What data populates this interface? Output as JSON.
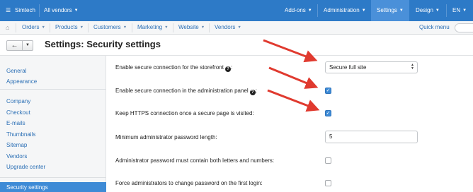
{
  "topbar": {
    "brand": "Simtech",
    "vendor_select": "All vendors",
    "addons": "Add-ons",
    "administration": "Administration",
    "settings": "Settings",
    "design": "Design",
    "language": "EN"
  },
  "nav": {
    "items": [
      "Orders",
      "Products",
      "Customers",
      "Marketing",
      "Website",
      "Vendors"
    ],
    "quick_menu": "Quick menu"
  },
  "page": {
    "title": "Settings: Security settings"
  },
  "sidebar": {
    "items": [
      "General",
      "Appearance",
      "Company",
      "Checkout",
      "E-mails",
      "Thumbnails",
      "Sitemap",
      "Vendors",
      "Upgrade center"
    ],
    "active": "Security settings"
  },
  "settings": {
    "rows": [
      {
        "label": "Enable secure connection for the storefront",
        "control": "select",
        "value": "Secure full site"
      },
      {
        "label": "Enable secure connection in the administration panel",
        "control": "checkbox",
        "checked": true
      },
      {
        "label": "Keep HTTPS connection once a secure page is visited:",
        "control": "checkbox",
        "checked": true
      },
      {
        "label": "Minimum administrator password length:",
        "control": "input",
        "value": "5"
      },
      {
        "label": "Administrator password must contain both letters and numbers:",
        "control": "checkbox",
        "checked": false
      },
      {
        "label": "Force administrators to change password on the first login:",
        "control": "checkbox",
        "checked": false
      }
    ]
  },
  "colors": {
    "topbar": "#2d7ac7",
    "accent": "#3e8bd6",
    "arrow": "#e03a2f"
  }
}
